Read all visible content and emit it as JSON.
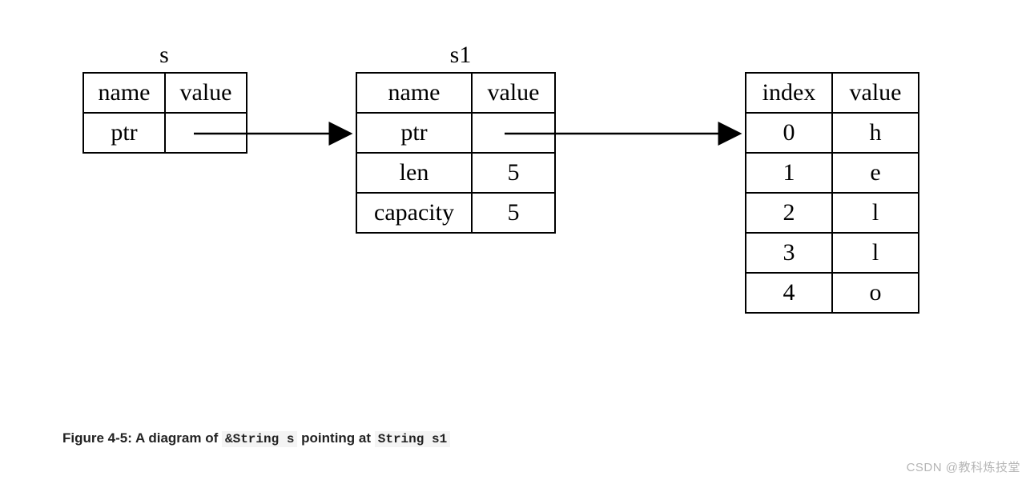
{
  "labels": {
    "s": "s",
    "s1": "s1"
  },
  "table_s": {
    "h_name": "name",
    "h_value": "value",
    "r0_name": "ptr",
    "r0_value": ""
  },
  "table_s1": {
    "h_name": "name",
    "h_value": "value",
    "r0_name": "ptr",
    "r0_value": "",
    "r1_name": "len",
    "r1_value": "5",
    "r2_name": "capacity",
    "r2_value": "5"
  },
  "table_heap": {
    "h_index": "index",
    "h_value": "value",
    "rows": [
      {
        "i": "0",
        "v": "h"
      },
      {
        "i": "1",
        "v": "e"
      },
      {
        "i": "2",
        "v": "l"
      },
      {
        "i": "3",
        "v": "l"
      },
      {
        "i": "4",
        "v": "o"
      }
    ]
  },
  "caption": {
    "prefix": "Figure 4-5: A diagram of ",
    "code1": "&String s",
    "mid": " pointing at ",
    "code2": "String s1"
  },
  "watermark": "CSDN @教科炼技堂"
}
